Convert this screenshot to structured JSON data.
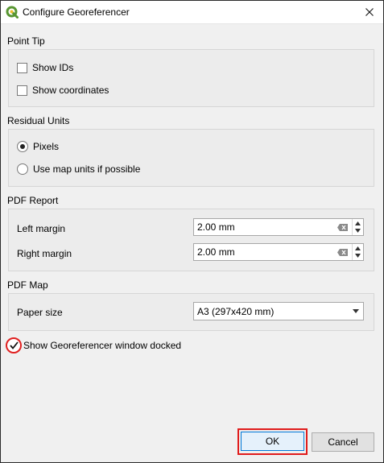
{
  "window": {
    "title": "Configure Georeferencer"
  },
  "point_tip": {
    "title": "Point Tip",
    "show_ids": {
      "label": "Show IDs",
      "checked": false
    },
    "show_coordinates": {
      "label": "Show coordinates",
      "checked": false
    }
  },
  "residual_units": {
    "title": "Residual Units",
    "options": [
      {
        "label": "Pixels",
        "selected": true
      },
      {
        "label": "Use map units if possible",
        "selected": false
      }
    ]
  },
  "pdf_report": {
    "title": "PDF Report",
    "left_margin": {
      "label": "Left margin",
      "value": "2.00 mm"
    },
    "right_margin": {
      "label": "Right margin",
      "value": "2.00 mm"
    }
  },
  "pdf_map": {
    "title": "PDF Map",
    "paper_size": {
      "label": "Paper size",
      "value": "A3 (297x420 mm)"
    }
  },
  "docked": {
    "label": "Show Georeferencer window docked",
    "checked": true
  },
  "buttons": {
    "ok": "OK",
    "cancel": "Cancel"
  },
  "colors": {
    "highlight": "#e01b1b",
    "qgis_green": "#589632",
    "qgis_yellow": "#eebd2c"
  }
}
